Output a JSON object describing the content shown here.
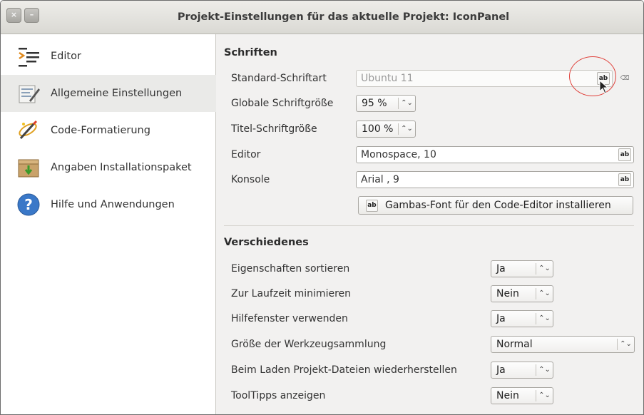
{
  "window": {
    "title": "Projekt-Einstellungen für das aktuelle Projekt:  IconPanel",
    "close_label": "×",
    "minimize_label": "–"
  },
  "sidebar": {
    "items": [
      {
        "label": "Editor",
        "icon": "editor-lines-icon"
      },
      {
        "label": "Allgemeine Einstellungen",
        "icon": "settings-sheet-icon"
      },
      {
        "label": "Code-Formatierung",
        "icon": "magic-wand-icon"
      },
      {
        "label": "Angaben Installationspaket",
        "icon": "package-box-icon"
      },
      {
        "label": "Hilfe und Anwendungen",
        "icon": "help-question-icon"
      }
    ],
    "active_index": 1
  },
  "fonts_section": {
    "title": "Schriften",
    "standard_font_label": "Standard-Schriftart",
    "standard_font_value": "Ubuntu 11",
    "global_size_label": "Globale Schriftgröße",
    "global_size_value": "95 %",
    "title_size_label": "Titel-Schriftgröße",
    "title_size_value": "100 %",
    "editor_label": "Editor",
    "editor_value": "Monospace, 10",
    "console_label": "Konsole",
    "console_value": "Arial , 9",
    "install_button_label": "Gambas-Font für den Code-Editor installieren",
    "font_button_glyph": "ab"
  },
  "misc_section": {
    "title": "Verschiedenes",
    "rows": [
      {
        "label": "Eigenschaften sortieren",
        "value": "Ja"
      },
      {
        "label": "Zur Laufzeit minimieren",
        "value": "Nein"
      },
      {
        "label": "Hilfefenster verwenden",
        "value": "Ja"
      },
      {
        "label": "Größe der Werkzeugsammlung",
        "value": "Normal"
      },
      {
        "label": "Beim Laden Projekt-Dateien wiederherstellen",
        "value": "Ja"
      },
      {
        "label": "ToolTipps anzeigen",
        "value": "Nein"
      }
    ]
  },
  "colors": {
    "highlight_circle": "#e0403a",
    "sidebar_active": "#eaeae8"
  }
}
